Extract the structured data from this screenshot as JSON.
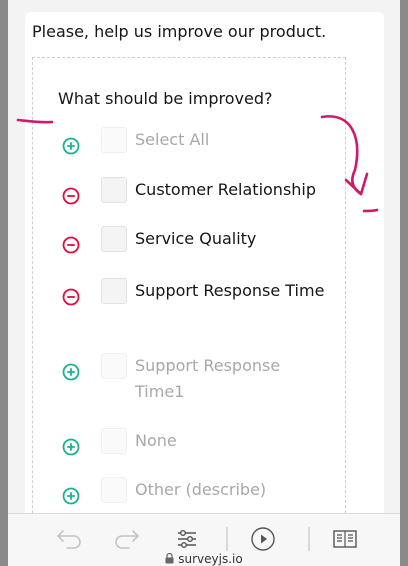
{
  "survey": {
    "title": "Please, help us improve our product.",
    "question_title": "What should be improved?",
    "choices": [
      {
        "label": "Select All",
        "state": "add",
        "faded": true
      },
      {
        "label": "Customer Relationship",
        "state": "remove",
        "faded": false
      },
      {
        "label": "Service Quality",
        "state": "remove",
        "faded": false
      },
      {
        "label": "Support Response Time",
        "state": "remove",
        "faded": false
      },
      {
        "label": "Support Response Time1",
        "state": "add",
        "faded": true
      },
      {
        "label": "None",
        "state": "add",
        "faded": true
      },
      {
        "label": "Other (describe)",
        "state": "add",
        "faded": true
      }
    ]
  },
  "browser": {
    "url": "surveyjs.io",
    "icons": [
      "back-icon",
      "forward-icon",
      "settings-icon",
      "play-icon",
      "reader-icon",
      "lock-icon"
    ]
  },
  "colors": {
    "add": "#19b394",
    "remove": "#e60a3e",
    "annotation": "#d0196b"
  }
}
